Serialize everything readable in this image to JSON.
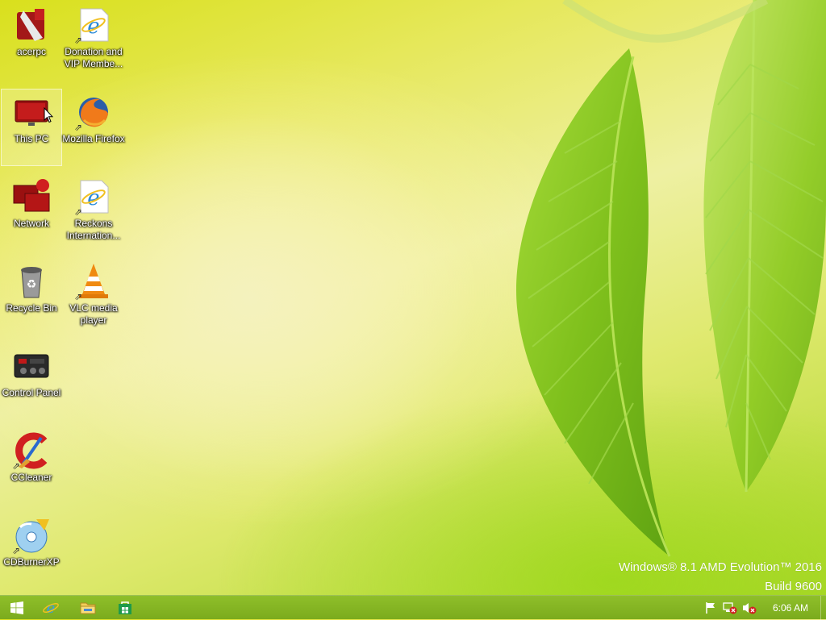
{
  "desktop": {
    "icons": [
      {
        "label": "acerpc",
        "icon": "user-folder-icon"
      },
      {
        "label": "Donation and VIP Membe...",
        "icon": "internet-explorer-shortcut-icon"
      },
      {
        "label": "This PC",
        "icon": "computer-icon"
      },
      {
        "label": "Mozilla Firefox",
        "icon": "firefox-icon"
      },
      {
        "label": "Network",
        "icon": "network-icon"
      },
      {
        "label": "Reckons Internation...",
        "icon": "internet-explorer-shortcut-icon"
      },
      {
        "label": "Recycle Bin",
        "icon": "recycle-bin-icon"
      },
      {
        "label": "VLC media player",
        "icon": "vlc-icon"
      },
      {
        "label": "Control Panel",
        "icon": "control-panel-icon"
      },
      {
        "label": "CCleaner",
        "icon": "ccleaner-icon"
      },
      {
        "label": "CDBurnerXP",
        "icon": "cdburnerxp-icon"
      }
    ],
    "selected": "This PC"
  },
  "watermark": {
    "line1": "Windows® 8.1 AMD Evolution™ 2016",
    "line2": "Build 9600"
  },
  "taskbar": {
    "pinned": [
      {
        "name": "start",
        "icon": "windows-logo-icon"
      },
      {
        "name": "internet-explorer",
        "icon": "internet-explorer-icon"
      },
      {
        "name": "file-explorer",
        "icon": "folder-icon"
      },
      {
        "name": "store",
        "icon": "store-icon"
      }
    ],
    "tray": [
      {
        "name": "action-center",
        "icon": "flag-icon"
      },
      {
        "name": "network-status",
        "icon": "network-disconnected-icon"
      },
      {
        "name": "volume",
        "icon": "speaker-muted-icon"
      }
    ],
    "clock": "6:06 AM"
  },
  "colors": {
    "taskbar": "#86b824",
    "wallpaper_light": "#eef0a2",
    "leaf_green": "#8dc51f"
  }
}
